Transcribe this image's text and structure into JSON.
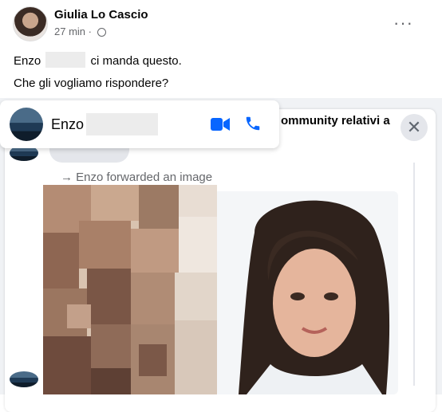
{
  "post": {
    "author": "Giulia Lo Cascio",
    "time": "27 min",
    "separator": "·",
    "text_line1_a": "Enzo",
    "text_line1_b": "ci manda questo.",
    "text_line2": "Che gli vogliamo rispondere?"
  },
  "background": {
    "title_fragment": "ommunity relativi a",
    "small_fragment": "a"
  },
  "chat": {
    "contact_name": "Enzo",
    "forward_label": "Enzo forwarded an image",
    "forward_arrow": "→",
    "close_glyph": "✕",
    "more_glyph": "···"
  },
  "colors": {
    "accent": "#0866ff",
    "muted": "#65676b"
  },
  "icons": [
    "globe-icon",
    "more-icon",
    "video-call-icon",
    "phone-icon",
    "close-icon"
  ]
}
